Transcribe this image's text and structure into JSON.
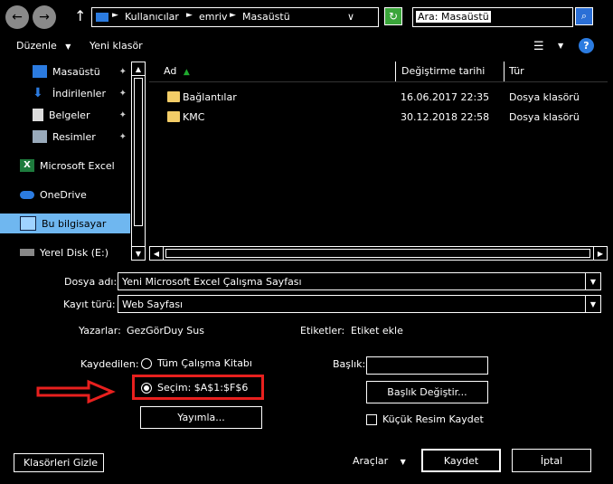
{
  "nav": {
    "breadcrumb": [
      "Kullanıcılar",
      "emriv",
      "Masaüstü"
    ],
    "search_placeholder": "Ara: Masaüstü"
  },
  "toolbar": {
    "organize_label": "Düzenle",
    "new_folder_label": "Yeni klasör"
  },
  "sidebar": {
    "items": [
      {
        "label": "Masaüstü",
        "icon": "desktop-icon",
        "pinned": true
      },
      {
        "label": "İndirilenler",
        "icon": "download-icon",
        "pinned": true
      },
      {
        "label": "Belgeler",
        "icon": "documents-icon",
        "pinned": true
      },
      {
        "label": "Resimler",
        "icon": "pictures-icon",
        "pinned": true
      },
      {
        "label": "Microsoft Excel",
        "icon": "excel-icon",
        "pinned": false
      },
      {
        "label": "OneDrive",
        "icon": "onedrive-icon",
        "pinned": false
      },
      {
        "label": "Bu bilgisayar",
        "icon": "computer-icon",
        "pinned": false,
        "selected": true
      },
      {
        "label": "Yerel Disk (E:)",
        "icon": "drive-icon",
        "pinned": false
      }
    ]
  },
  "filelist": {
    "columns": [
      "Ad",
      "Değiştirme tarihi",
      "Tür"
    ],
    "rows": [
      {
        "name": "Bağlantılar",
        "date": "16.06.2017 22:35",
        "type": "Dosya klasörü"
      },
      {
        "name": "KMC",
        "date": "30.12.2018 22:58",
        "type": "Dosya klasörü"
      }
    ]
  },
  "form": {
    "filename_label": "Dosya adı:",
    "filename_value": "Yeni Microsoft Excel Çalışma Sayfası",
    "filetype_label": "Kayıt türü:",
    "filetype_value": "Web Sayfası",
    "authors_label": "Yazarlar:",
    "authors_value": "GezGörDuy Sus",
    "tags_label": "Etiketler:",
    "tags_value": "Etiket ekle",
    "saved_label": "Kaydedilen:",
    "option_workbook": "Tüm Çalışma Kitabı",
    "option_selection": "Seçim: $A$1:$F$6",
    "publish_label": "Yayımla...",
    "title_label": "Başlık:",
    "change_title_label": "Başlık Değiştir...",
    "thumbnail_label": "Küçük Resim Kaydet"
  },
  "footer": {
    "hide_folders_label": "Klasörleri Gizle",
    "tools_label": "Araçlar",
    "save_label": "Kaydet",
    "cancel_label": "İptal"
  },
  "colors": {
    "selection": "#6fb7f0",
    "annotation": "#e8201e",
    "folder": "#f3cd67"
  }
}
